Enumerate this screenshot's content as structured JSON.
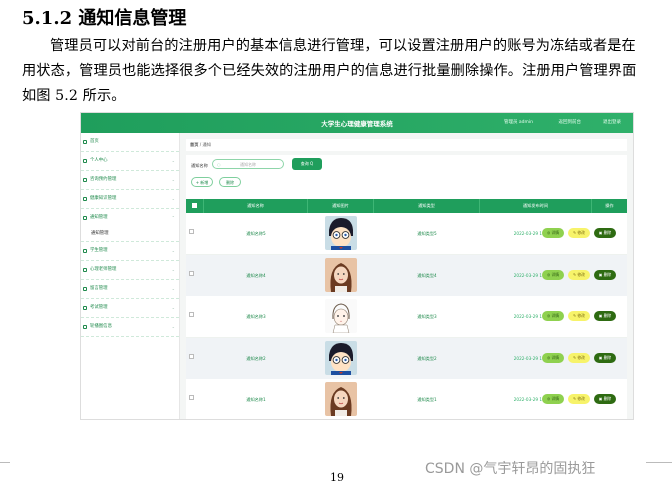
{
  "document": {
    "section_heading": "5.1.2 通知信息管理",
    "paragraph": "管理员可以对前台的注册用户的基本信息进行管理，可以设置注册用户的账号为冻结或者是在用状态，管理员也能选择很多个已经失效的注册用户的信息进行批量删除操作。注册用户管理界面如图 5.2 所示。",
    "page_number": "19",
    "watermark": "CSDN @气宇轩昂的固执狂"
  },
  "app": {
    "title": "大学生心理健康管理系统",
    "user_label": "管理员 admin",
    "topbar_links": [
      "返回到前台",
      "退出登录"
    ]
  },
  "sidebar": {
    "items": [
      {
        "label": "首页",
        "icon": "home-icon"
      },
      {
        "label": "个人中心",
        "icon": "user-icon"
      },
      {
        "label": "咨询预约管理",
        "icon": "calendar-icon"
      },
      {
        "label": "健康知识管理",
        "icon": "book-icon"
      },
      {
        "label": "通知管理",
        "icon": "bell-icon"
      },
      {
        "label": "学生管理",
        "icon": "student-icon"
      },
      {
        "label": "心理老师管理",
        "icon": "teacher-icon"
      },
      {
        "label": "留言管理",
        "icon": "message-icon"
      },
      {
        "label": "考试管理",
        "icon": "exam-icon"
      },
      {
        "label": "轮播图信息",
        "icon": "image-icon"
      }
    ],
    "active_sub": "通知管理"
  },
  "breadcrumb": {
    "home": "首页",
    "sep": "/",
    "current": "通知"
  },
  "search": {
    "label": "通知名称",
    "placeholder": "通知名称",
    "button": "查询 Q"
  },
  "toolbar": {
    "add": "+ 新增",
    "delete": "删除"
  },
  "table": {
    "headers": [
      "通知名称",
      "通知图片",
      "通知类型",
      "通知发布时间",
      "操作"
    ],
    "rows": [
      {
        "name": "通知名称5",
        "type": "通知类型5",
        "time": "2022-03-29 11:39:43",
        "avatar": "conan"
      },
      {
        "name": "通知名称4",
        "type": "通知类型4",
        "time": "2022-03-29 11:39:43",
        "avatar": "girl"
      },
      {
        "name": "通知名称3",
        "type": "通知类型3",
        "time": "2022-03-29 11:39:43",
        "avatar": "sketch"
      },
      {
        "name": "通知名称2",
        "type": "通知类型2",
        "time": "2022-03-29 11:39:43",
        "avatar": "conan"
      },
      {
        "name": "通知名称1",
        "type": "通知类型1",
        "time": "2022-03-29 11:39:43",
        "avatar": "girl"
      }
    ],
    "actions": [
      "详情",
      "修改",
      "删除"
    ]
  },
  "colors": {
    "primary": "#1f9e5c",
    "detail": "#8fd14f",
    "edit": "#f7f36a",
    "delete": "#2e6b12"
  }
}
